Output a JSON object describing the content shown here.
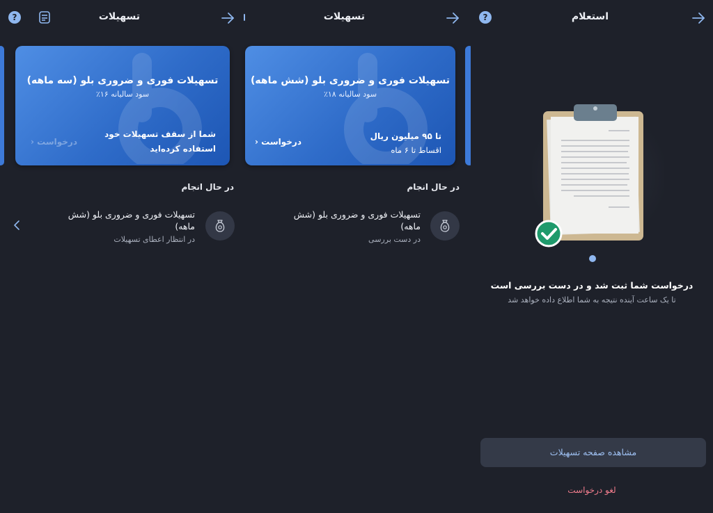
{
  "panel_left": {
    "header_title": "تسهیلات",
    "card": {
      "title": "تسهیلات فوری و ضروری بلو (سه ماهه)",
      "subtitle": "سود سالیانه ۱۶٪",
      "line1": "شما از سقف تسهیلات خود",
      "line2": "استفاده کرده‌اید",
      "action": "درخواست"
    },
    "section_title": "در حال انجام",
    "item": {
      "title": "تسهیلات فوری و ضروری بلو (شش ماهه)",
      "status": "در انتظار اعطای تسهیلات"
    }
  },
  "panel_middle": {
    "header_title": "تسهیلات",
    "card": {
      "title": "تسهیلات فوری و ضروری بلو (شش ماهه)",
      "subtitle": "سود سالیانه ۱۸٪",
      "line1": "تا ۹۵ میلیون ریال",
      "line2": "اقساط تا ۶ ماه",
      "action": "درخواست"
    },
    "section_title": "در حال انجام",
    "item": {
      "title": "تسهیلات فوری و ضروری بلو (شش ماهه)",
      "status": "در دست بررسی"
    }
  },
  "panel_right": {
    "header_title": "استعلام",
    "message_title": "درخواست شما ثبت شد و در دست بررسی است",
    "message_subtitle": "تا یک ساعت آینده نتیجه به شما اطلاع داده خواهد شد",
    "primary_button": "مشاهده صفحه تسهیلات",
    "cancel_link": "لغو درخواست"
  },
  "icons": {
    "back": "arrow-right-icon",
    "help": "?",
    "list": "document-list-icon",
    "money_bag": "money-bag-icon",
    "success": "check-circle-icon"
  },
  "colors": {
    "background": "#1e212a",
    "card_blue": "#2f6cc9",
    "accent": "#8fb7ef",
    "danger": "#f07c8c",
    "success": "#1f9a6c"
  }
}
